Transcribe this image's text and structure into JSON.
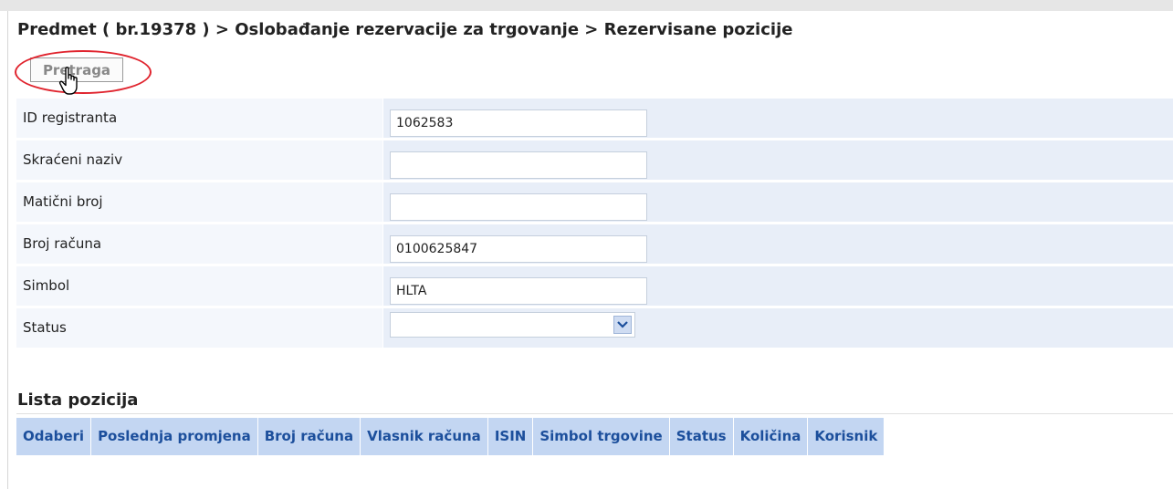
{
  "breadcrumb": "Predmet ( br.19378 ) > Oslobađanje rezervacije za trgovanje > Rezervisane pozicije",
  "search_button": "Pretraga",
  "form": [
    {
      "label": "ID registranta",
      "value": ""
    },
    {
      "label": "Skraćeni naziv",
      "value": ""
    },
    {
      "label": "Matični broj",
      "value": ""
    },
    {
      "label": "Broj računa",
      "value": ""
    },
    {
      "label": "Simbol",
      "value": ""
    },
    {
      "label": "Status",
      "value": ""
    }
  ],
  "form_values": {
    "id_registranta": "1062583",
    "skraceni_naziv": "",
    "maticni_broj": "",
    "broj_racuna": "0100625847",
    "simbol": "HLTA",
    "status": ""
  },
  "list_title": "Lista pozicija",
  "table_columns": [
    "Odaberi",
    "Poslednja promjena",
    "Broj računa",
    "Vlasnik računa",
    "ISIN",
    "Simbol trgovine",
    "Status",
    "Količina",
    "Korisnik"
  ],
  "colors": {
    "header_bg": "#c3d6f2",
    "header_text": "#1c4f9c",
    "highlight": "#e0242e"
  }
}
